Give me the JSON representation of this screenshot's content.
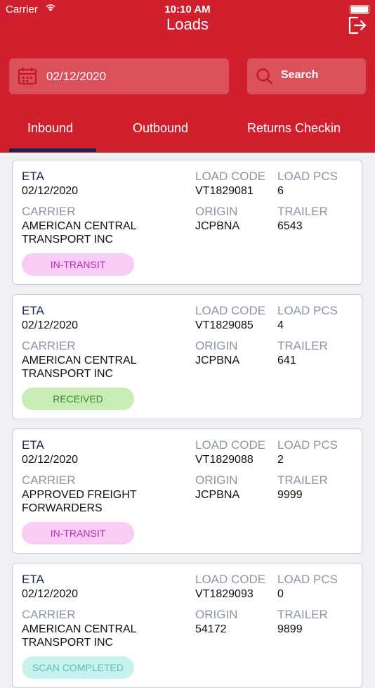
{
  "status_bar": {
    "carrier": "Carrier",
    "time": "10:10 AM"
  },
  "header": {
    "title": "Loads"
  },
  "filters": {
    "date": "02/12/2020",
    "search_label": "Search"
  },
  "tabs": [
    "Inbound",
    "Outbound",
    "Returns Checkin"
  ],
  "labels": {
    "eta": "ETA",
    "load_code": "LOAD CODE",
    "load_pcs": "LOAD PCS",
    "carrier": "CARRIER",
    "origin": "ORIGIN",
    "trailer": "TRAILER"
  },
  "loads": [
    {
      "eta": "02/12/2020",
      "load_code": "VT1829081",
      "load_pcs": "6",
      "carrier_line1": "AMERICAN CENTRAL",
      "carrier_line2": "TRANSPORT INC",
      "origin": "JCPBNA",
      "trailer": "6543",
      "status": "IN-TRANSIT"
    },
    {
      "eta": "02/12/2020",
      "load_code": "VT1829085",
      "load_pcs": "4",
      "carrier_line1": "AMERICAN CENTRAL",
      "carrier_line2": "TRANSPORT INC",
      "origin": "JCPBNA",
      "trailer": "641",
      "status": "RECEIVED"
    },
    {
      "eta": "02/12/2020",
      "load_code": "VT1829088",
      "load_pcs": "2",
      "carrier_line1": "APPROVED FREIGHT",
      "carrier_line2": "FORWARDERS",
      "origin": "JCPBNA",
      "trailer": "9999",
      "status": "IN-TRANSIT"
    },
    {
      "eta": "02/12/2020",
      "load_code": "VT1829093",
      "load_pcs": "0",
      "carrier_line1": "AMERICAN CENTRAL",
      "carrier_line2": "TRANSPORT INC",
      "origin": "54172",
      "trailer": "9899",
      "status": "SCAN COMPLETED"
    }
  ],
  "colors": {
    "header": "#d0202e",
    "tab_indicator": "#1a2450"
  }
}
